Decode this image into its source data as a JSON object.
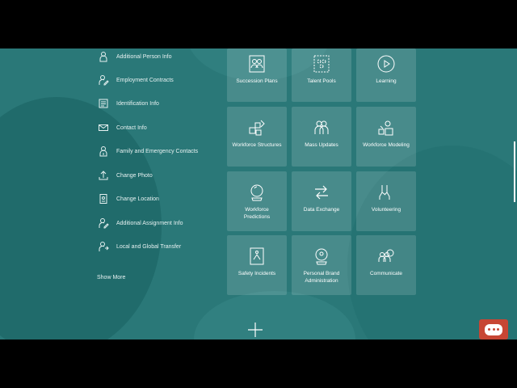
{
  "quick_actions": [
    {
      "label": "Additional Person Info",
      "icon": "person-add-icon"
    },
    {
      "label": "Employment Contracts",
      "icon": "person-edit-icon"
    },
    {
      "label": "Identification Info",
      "icon": "id-card-icon"
    },
    {
      "label": "Contact Info",
      "icon": "envelope-icon"
    },
    {
      "label": "Family and Emergency Contacts",
      "icon": "family-contacts-icon"
    },
    {
      "label": "Change Photo",
      "icon": "upload-photo-icon"
    },
    {
      "label": "Change Location",
      "icon": "location-badge-icon"
    },
    {
      "label": "Additional Assignment Info",
      "icon": "assignment-edit-icon"
    },
    {
      "label": "Local and Global Transfer",
      "icon": "transfer-person-icon"
    }
  ],
  "show_more": "Show More",
  "tiles": [
    {
      "label": "Succession Plans",
      "icon": "succession-plans-icon"
    },
    {
      "label": "Talent Pools",
      "icon": "talent-pools-icon"
    },
    {
      "label": "Learning",
      "icon": "learning-play-icon"
    },
    {
      "label": "Workforce Structures",
      "icon": "workforce-structures-icon"
    },
    {
      "label": "Mass Updates",
      "icon": "mass-updates-icon"
    },
    {
      "label": "Workforce Modeling",
      "icon": "workforce-modeling-icon"
    },
    {
      "label": "Workforce Predictions",
      "icon": "crystal-ball-icon"
    },
    {
      "label": "Data Exchange",
      "icon": "data-exchange-icon"
    },
    {
      "label": "Volunteering",
      "icon": "volunteering-hands-icon"
    },
    {
      "label": "Safety Incidents",
      "icon": "safety-incident-icon"
    },
    {
      "label": "Personal Brand Administration",
      "icon": "personal-brand-icon"
    },
    {
      "label": "Communicate",
      "icon": "communicate-people-icon"
    }
  ],
  "colors": {
    "background": "#2a7878",
    "tile": "rgba(255,255,255,0.14)",
    "chat_button": "#c74634"
  }
}
